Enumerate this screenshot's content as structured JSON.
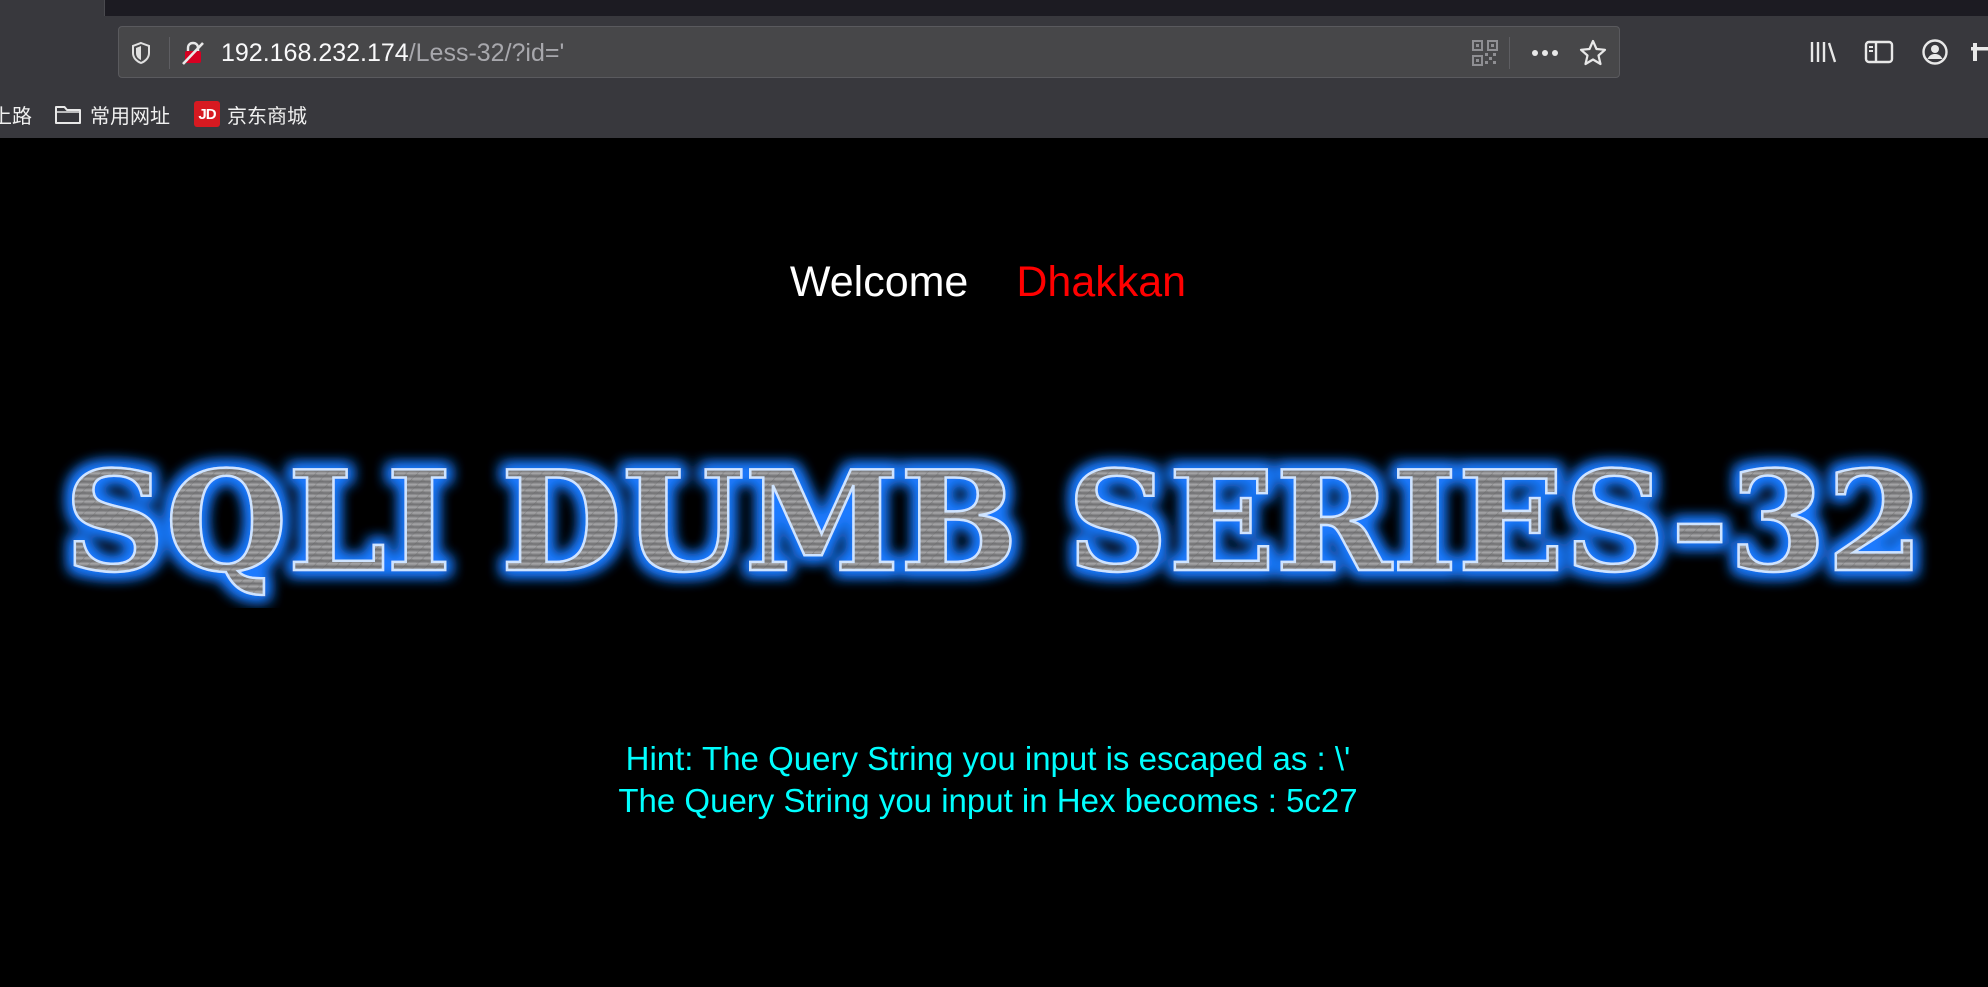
{
  "browser": {
    "address_host": "192.168.232.174",
    "address_path": "/Less-32/?id='",
    "icons": {
      "tracking": "shield-icon",
      "security": "insecure-lock-icon",
      "qr": "qr-code-icon",
      "page_actions": "more-horizontal-icon",
      "bookmark": "star-icon",
      "library": "library-icon",
      "sidebar": "sidebar-icon",
      "account": "account-icon"
    }
  },
  "bookmarks": {
    "partial_item": "上路",
    "folder_label": "常用网址",
    "jd_badge": "JD",
    "jd_label": "京东商城"
  },
  "page": {
    "welcome_word": "Welcome",
    "welcome_name": "Dhakkan",
    "banner_text": "SQLI DUMB SERIES-32",
    "hint_line1": "Hint: The Query String you input is escaped as : \\'",
    "hint_line2": "The Query String you input in Hex becomes : 5c27",
    "colors": {
      "background": "#000000",
      "welcome": "#ffffff",
      "name": "#ff0000",
      "hint": "#00ffff",
      "banner_glow": "#1e7bff"
    }
  }
}
